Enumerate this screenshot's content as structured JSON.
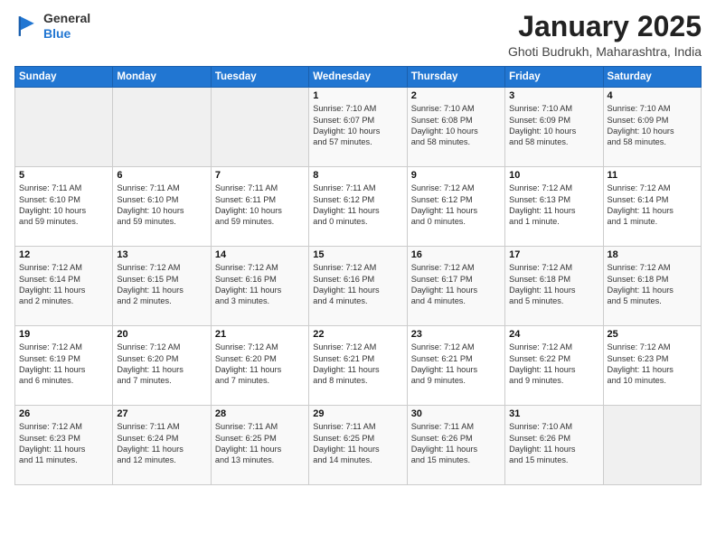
{
  "header": {
    "logo_general": "General",
    "logo_blue": "Blue",
    "title": "January 2025",
    "subtitle": "Ghoti Budrukh, Maharashtra, India"
  },
  "weekdays": [
    "Sunday",
    "Monday",
    "Tuesday",
    "Wednesday",
    "Thursday",
    "Friday",
    "Saturday"
  ],
  "weeks": [
    [
      {
        "day": "",
        "info": ""
      },
      {
        "day": "",
        "info": ""
      },
      {
        "day": "",
        "info": ""
      },
      {
        "day": "1",
        "info": "Sunrise: 7:10 AM\nSunset: 6:07 PM\nDaylight: 10 hours\nand 57 minutes."
      },
      {
        "day": "2",
        "info": "Sunrise: 7:10 AM\nSunset: 6:08 PM\nDaylight: 10 hours\nand 58 minutes."
      },
      {
        "day": "3",
        "info": "Sunrise: 7:10 AM\nSunset: 6:09 PM\nDaylight: 10 hours\nand 58 minutes."
      },
      {
        "day": "4",
        "info": "Sunrise: 7:10 AM\nSunset: 6:09 PM\nDaylight: 10 hours\nand 58 minutes."
      }
    ],
    [
      {
        "day": "5",
        "info": "Sunrise: 7:11 AM\nSunset: 6:10 PM\nDaylight: 10 hours\nand 59 minutes."
      },
      {
        "day": "6",
        "info": "Sunrise: 7:11 AM\nSunset: 6:10 PM\nDaylight: 10 hours\nand 59 minutes."
      },
      {
        "day": "7",
        "info": "Sunrise: 7:11 AM\nSunset: 6:11 PM\nDaylight: 10 hours\nand 59 minutes."
      },
      {
        "day": "8",
        "info": "Sunrise: 7:11 AM\nSunset: 6:12 PM\nDaylight: 11 hours\nand 0 minutes."
      },
      {
        "day": "9",
        "info": "Sunrise: 7:12 AM\nSunset: 6:12 PM\nDaylight: 11 hours\nand 0 minutes."
      },
      {
        "day": "10",
        "info": "Sunrise: 7:12 AM\nSunset: 6:13 PM\nDaylight: 11 hours\nand 1 minute."
      },
      {
        "day": "11",
        "info": "Sunrise: 7:12 AM\nSunset: 6:14 PM\nDaylight: 11 hours\nand 1 minute."
      }
    ],
    [
      {
        "day": "12",
        "info": "Sunrise: 7:12 AM\nSunset: 6:14 PM\nDaylight: 11 hours\nand 2 minutes."
      },
      {
        "day": "13",
        "info": "Sunrise: 7:12 AM\nSunset: 6:15 PM\nDaylight: 11 hours\nand 2 minutes."
      },
      {
        "day": "14",
        "info": "Sunrise: 7:12 AM\nSunset: 6:16 PM\nDaylight: 11 hours\nand 3 minutes."
      },
      {
        "day": "15",
        "info": "Sunrise: 7:12 AM\nSunset: 6:16 PM\nDaylight: 11 hours\nand 4 minutes."
      },
      {
        "day": "16",
        "info": "Sunrise: 7:12 AM\nSunset: 6:17 PM\nDaylight: 11 hours\nand 4 minutes."
      },
      {
        "day": "17",
        "info": "Sunrise: 7:12 AM\nSunset: 6:18 PM\nDaylight: 11 hours\nand 5 minutes."
      },
      {
        "day": "18",
        "info": "Sunrise: 7:12 AM\nSunset: 6:18 PM\nDaylight: 11 hours\nand 5 minutes."
      }
    ],
    [
      {
        "day": "19",
        "info": "Sunrise: 7:12 AM\nSunset: 6:19 PM\nDaylight: 11 hours\nand 6 minutes."
      },
      {
        "day": "20",
        "info": "Sunrise: 7:12 AM\nSunset: 6:20 PM\nDaylight: 11 hours\nand 7 minutes."
      },
      {
        "day": "21",
        "info": "Sunrise: 7:12 AM\nSunset: 6:20 PM\nDaylight: 11 hours\nand 7 minutes."
      },
      {
        "day": "22",
        "info": "Sunrise: 7:12 AM\nSunset: 6:21 PM\nDaylight: 11 hours\nand 8 minutes."
      },
      {
        "day": "23",
        "info": "Sunrise: 7:12 AM\nSunset: 6:21 PM\nDaylight: 11 hours\nand 9 minutes."
      },
      {
        "day": "24",
        "info": "Sunrise: 7:12 AM\nSunset: 6:22 PM\nDaylight: 11 hours\nand 9 minutes."
      },
      {
        "day": "25",
        "info": "Sunrise: 7:12 AM\nSunset: 6:23 PM\nDaylight: 11 hours\nand 10 minutes."
      }
    ],
    [
      {
        "day": "26",
        "info": "Sunrise: 7:12 AM\nSunset: 6:23 PM\nDaylight: 11 hours\nand 11 minutes."
      },
      {
        "day": "27",
        "info": "Sunrise: 7:11 AM\nSunset: 6:24 PM\nDaylight: 11 hours\nand 12 minutes."
      },
      {
        "day": "28",
        "info": "Sunrise: 7:11 AM\nSunset: 6:25 PM\nDaylight: 11 hours\nand 13 minutes."
      },
      {
        "day": "29",
        "info": "Sunrise: 7:11 AM\nSunset: 6:25 PM\nDaylight: 11 hours\nand 14 minutes."
      },
      {
        "day": "30",
        "info": "Sunrise: 7:11 AM\nSunset: 6:26 PM\nDaylight: 11 hours\nand 15 minutes."
      },
      {
        "day": "31",
        "info": "Sunrise: 7:10 AM\nSunset: 6:26 PM\nDaylight: 11 hours\nand 15 minutes."
      },
      {
        "day": "",
        "info": ""
      }
    ]
  ]
}
